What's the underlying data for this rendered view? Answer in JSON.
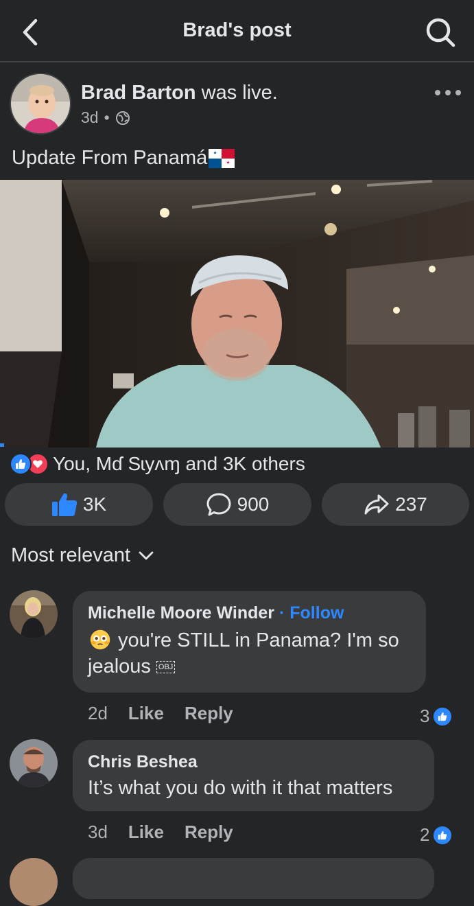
{
  "header": {
    "title": "Brad's post"
  },
  "post": {
    "author": "Brad Barton",
    "action": " was live.",
    "time": "3d",
    "separator": "•",
    "text": "Update From Panamá"
  },
  "reactions": {
    "summary": "You, Mɗ Sɩyʌɱ and 3K others"
  },
  "actions": {
    "likes": "3K",
    "comments": "900",
    "shares": "237"
  },
  "sort": {
    "label": "Most relevant"
  },
  "comments": [
    {
      "name": "Michelle Moore Winder",
      "dot": " · ",
      "follow": "Follow",
      "text_line1": "you're STILL in Panama? I'm so",
      "text_line2": "jealous",
      "obj": "OBJ",
      "time": "2d",
      "like": "Like",
      "reply": "Reply",
      "likes": "3"
    },
    {
      "name": "Chris Beshea",
      "text": "It’s what you do with it that matters",
      "time": "3d",
      "like": "Like",
      "reply": "Reply",
      "likes": "2"
    }
  ],
  "colors": {
    "background": "#242526",
    "accent": "#2d88ff",
    "bubble": "#3a3b3c"
  }
}
